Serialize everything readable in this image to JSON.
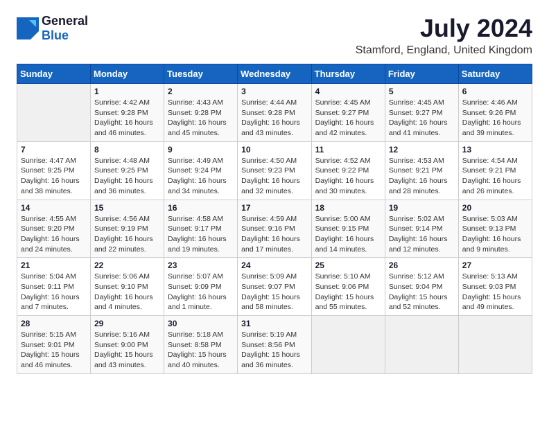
{
  "header": {
    "logo_general": "General",
    "logo_blue": "Blue",
    "title": "July 2024",
    "subtitle": "Stamford, England, United Kingdom"
  },
  "weekdays": [
    "Sunday",
    "Monday",
    "Tuesday",
    "Wednesday",
    "Thursday",
    "Friday",
    "Saturday"
  ],
  "weeks": [
    [
      {
        "day": "",
        "info": ""
      },
      {
        "day": "1",
        "info": "Sunrise: 4:42 AM\nSunset: 9:28 PM\nDaylight: 16 hours\nand 46 minutes."
      },
      {
        "day": "2",
        "info": "Sunrise: 4:43 AM\nSunset: 9:28 PM\nDaylight: 16 hours\nand 45 minutes."
      },
      {
        "day": "3",
        "info": "Sunrise: 4:44 AM\nSunset: 9:28 PM\nDaylight: 16 hours\nand 43 minutes."
      },
      {
        "day": "4",
        "info": "Sunrise: 4:45 AM\nSunset: 9:27 PM\nDaylight: 16 hours\nand 42 minutes."
      },
      {
        "day": "5",
        "info": "Sunrise: 4:45 AM\nSunset: 9:27 PM\nDaylight: 16 hours\nand 41 minutes."
      },
      {
        "day": "6",
        "info": "Sunrise: 4:46 AM\nSunset: 9:26 PM\nDaylight: 16 hours\nand 39 minutes."
      }
    ],
    [
      {
        "day": "7",
        "info": "Sunrise: 4:47 AM\nSunset: 9:25 PM\nDaylight: 16 hours\nand 38 minutes."
      },
      {
        "day": "8",
        "info": "Sunrise: 4:48 AM\nSunset: 9:25 PM\nDaylight: 16 hours\nand 36 minutes."
      },
      {
        "day": "9",
        "info": "Sunrise: 4:49 AM\nSunset: 9:24 PM\nDaylight: 16 hours\nand 34 minutes."
      },
      {
        "day": "10",
        "info": "Sunrise: 4:50 AM\nSunset: 9:23 PM\nDaylight: 16 hours\nand 32 minutes."
      },
      {
        "day": "11",
        "info": "Sunrise: 4:52 AM\nSunset: 9:22 PM\nDaylight: 16 hours\nand 30 minutes."
      },
      {
        "day": "12",
        "info": "Sunrise: 4:53 AM\nSunset: 9:21 PM\nDaylight: 16 hours\nand 28 minutes."
      },
      {
        "day": "13",
        "info": "Sunrise: 4:54 AM\nSunset: 9:21 PM\nDaylight: 16 hours\nand 26 minutes."
      }
    ],
    [
      {
        "day": "14",
        "info": "Sunrise: 4:55 AM\nSunset: 9:20 PM\nDaylight: 16 hours\nand 24 minutes."
      },
      {
        "day": "15",
        "info": "Sunrise: 4:56 AM\nSunset: 9:19 PM\nDaylight: 16 hours\nand 22 minutes."
      },
      {
        "day": "16",
        "info": "Sunrise: 4:58 AM\nSunset: 9:17 PM\nDaylight: 16 hours\nand 19 minutes."
      },
      {
        "day": "17",
        "info": "Sunrise: 4:59 AM\nSunset: 9:16 PM\nDaylight: 16 hours\nand 17 minutes."
      },
      {
        "day": "18",
        "info": "Sunrise: 5:00 AM\nSunset: 9:15 PM\nDaylight: 16 hours\nand 14 minutes."
      },
      {
        "day": "19",
        "info": "Sunrise: 5:02 AM\nSunset: 9:14 PM\nDaylight: 16 hours\nand 12 minutes."
      },
      {
        "day": "20",
        "info": "Sunrise: 5:03 AM\nSunset: 9:13 PM\nDaylight: 16 hours\nand 9 minutes."
      }
    ],
    [
      {
        "day": "21",
        "info": "Sunrise: 5:04 AM\nSunset: 9:11 PM\nDaylight: 16 hours\nand 7 minutes."
      },
      {
        "day": "22",
        "info": "Sunrise: 5:06 AM\nSunset: 9:10 PM\nDaylight: 16 hours\nand 4 minutes."
      },
      {
        "day": "23",
        "info": "Sunrise: 5:07 AM\nSunset: 9:09 PM\nDaylight: 16 hours\nand 1 minute."
      },
      {
        "day": "24",
        "info": "Sunrise: 5:09 AM\nSunset: 9:07 PM\nDaylight: 15 hours\nand 58 minutes."
      },
      {
        "day": "25",
        "info": "Sunrise: 5:10 AM\nSunset: 9:06 PM\nDaylight: 15 hours\nand 55 minutes."
      },
      {
        "day": "26",
        "info": "Sunrise: 5:12 AM\nSunset: 9:04 PM\nDaylight: 15 hours\nand 52 minutes."
      },
      {
        "day": "27",
        "info": "Sunrise: 5:13 AM\nSunset: 9:03 PM\nDaylight: 15 hours\nand 49 minutes."
      }
    ],
    [
      {
        "day": "28",
        "info": "Sunrise: 5:15 AM\nSunset: 9:01 PM\nDaylight: 15 hours\nand 46 minutes."
      },
      {
        "day": "29",
        "info": "Sunrise: 5:16 AM\nSunset: 9:00 PM\nDaylight: 15 hours\nand 43 minutes."
      },
      {
        "day": "30",
        "info": "Sunrise: 5:18 AM\nSunset: 8:58 PM\nDaylight: 15 hours\nand 40 minutes."
      },
      {
        "day": "31",
        "info": "Sunrise: 5:19 AM\nSunset: 8:56 PM\nDaylight: 15 hours\nand 36 minutes."
      },
      {
        "day": "",
        "info": ""
      },
      {
        "day": "",
        "info": ""
      },
      {
        "day": "",
        "info": ""
      }
    ]
  ]
}
